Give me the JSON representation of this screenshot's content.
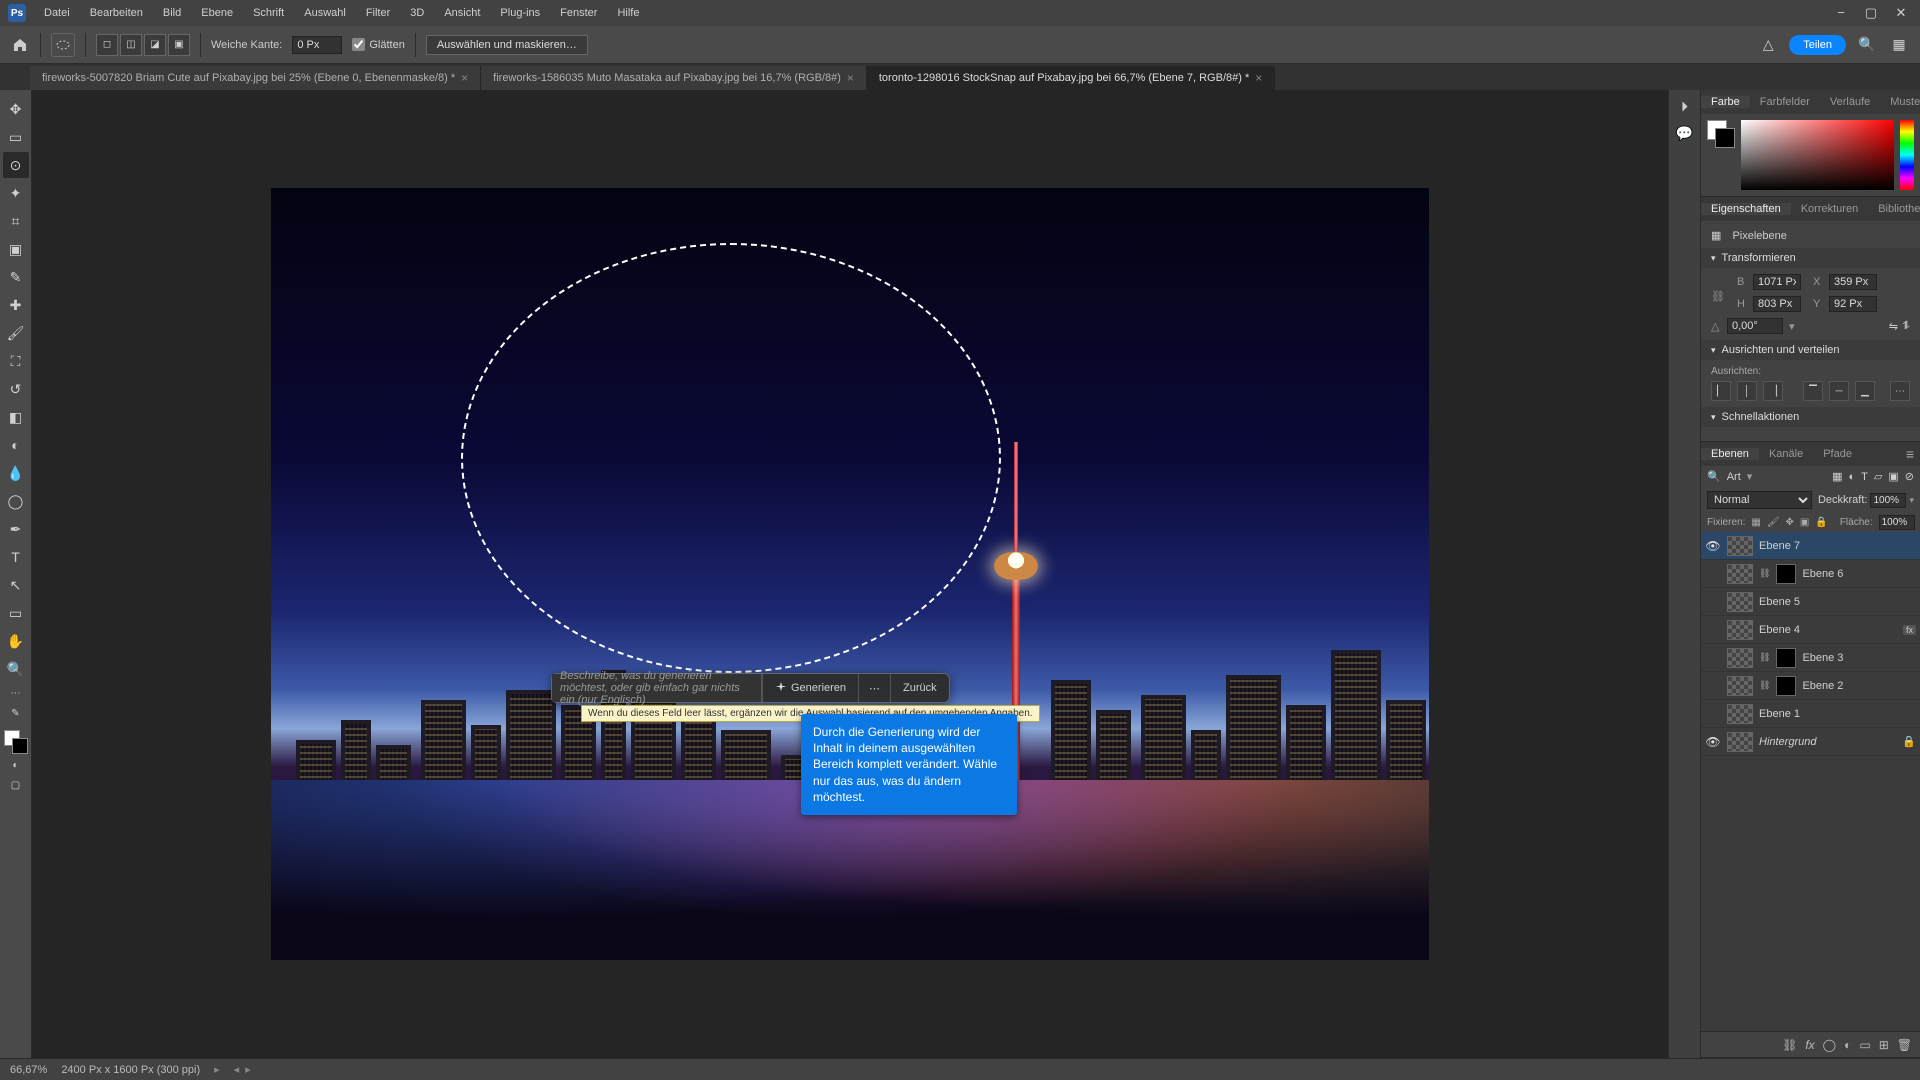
{
  "menu": {
    "items": [
      "Datei",
      "Bearbeiten",
      "Bild",
      "Ebene",
      "Schrift",
      "Auswahl",
      "Filter",
      "3D",
      "Ansicht",
      "Plug-ins",
      "Fenster",
      "Hilfe"
    ]
  },
  "options": {
    "feather_label": "Weiche Kante:",
    "feather_value": "0 Px",
    "antialias_label": "Glätten",
    "mask_button": "Auswählen und maskieren…",
    "share_label": "Teilen"
  },
  "tabs": [
    {
      "label": "fireworks-5007820 Briam Cute auf Pixabay.jpg bei 25% (Ebene 0, Ebenenmaske/8) *"
    },
    {
      "label": "fireworks-1586035 Muto Masataka auf Pixabay.jpg bei 16,7% (RGB/8#)"
    },
    {
      "label": "toronto-1298016 StockSnap auf Pixabay.jpg bei 66,7% (Ebene 7, RGB/8#) *"
    }
  ],
  "generative": {
    "prompt_placeholder": "Beschreibe, was du generieren möchtest, oder gib einfach gar nichts ein (nur Englisch)",
    "generate": "Generieren",
    "back": "Zurück",
    "hint": "Wenn du dieses Feld leer lässt, ergänzen wir die Auswahl basierend auf den umgebenden Angaben.",
    "info": "Durch die Generierung wird der Inhalt in deinem ausgewählten Bereich komplett verändert. Wähle nur das aus, was du ändern möchtest."
  },
  "color_panel": {
    "tabs": [
      "Farbe",
      "Farbfelder",
      "Verläufe",
      "Muster"
    ]
  },
  "props_panel": {
    "tabs": [
      "Eigenschaften",
      "Korrekturen",
      "Bibliotheken"
    ],
    "kind": "Pixelebene",
    "sect_transform": "Transformieren",
    "W": "1071 Px",
    "X": "359 Px",
    "H": "803 Px",
    "Y": "92 Px",
    "angle": "0,00°",
    "sect_align": "Ausrichten und verteilen",
    "align_label": "Ausrichten:",
    "sect_quick": "Schnellaktionen"
  },
  "layer_panel": {
    "tabs": [
      "Ebenen",
      "Kanäle",
      "Pfade"
    ],
    "filter_label": "Art",
    "blend_mode": "Normal",
    "opacity_label": "Deckkraft:",
    "opacity_value": "100%",
    "lock_label": "Fixieren:",
    "fill_label": "Fläche:",
    "fill_value": "100%",
    "layers": [
      {
        "name": "Ebene 7",
        "visible": true,
        "selected": true,
        "has_mask": false,
        "fx": false,
        "locked": false
      },
      {
        "name": "Ebene 6",
        "visible": false,
        "selected": false,
        "has_mask": true,
        "fx": false,
        "locked": false
      },
      {
        "name": "Ebene 5",
        "visible": false,
        "selected": false,
        "has_mask": false,
        "fx": false,
        "locked": false
      },
      {
        "name": "Ebene 4",
        "visible": false,
        "selected": false,
        "has_mask": false,
        "fx": true,
        "locked": false
      },
      {
        "name": "Ebene 3",
        "visible": false,
        "selected": false,
        "has_mask": true,
        "fx": false,
        "locked": false
      },
      {
        "name": "Ebene 2",
        "visible": false,
        "selected": false,
        "has_mask": true,
        "fx": false,
        "locked": false
      },
      {
        "name": "Ebene 1",
        "visible": false,
        "selected": false,
        "has_mask": false,
        "fx": false,
        "locked": false
      },
      {
        "name": "Hintergrund",
        "visible": true,
        "selected": false,
        "has_mask": false,
        "fx": false,
        "locked": true
      }
    ]
  },
  "status": {
    "zoom": "66,67%",
    "docinfo": "2400 Px x 1600 Px (300 ppi)"
  }
}
